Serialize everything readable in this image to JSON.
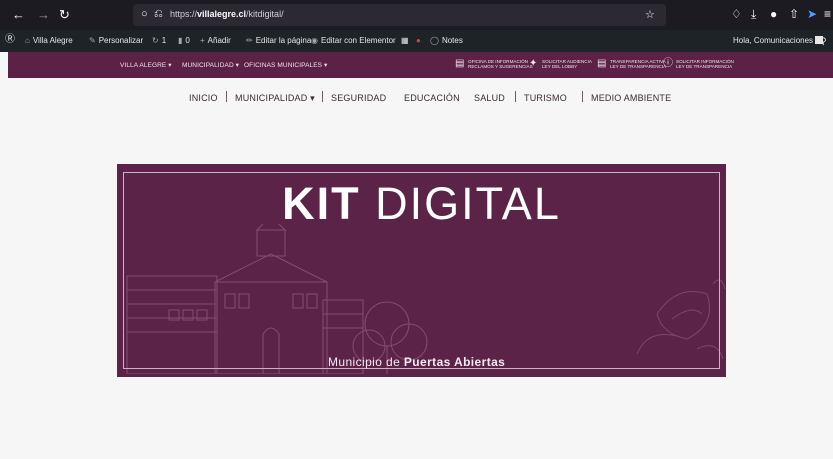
{
  "browser": {
    "url_prefix": "https://",
    "url_domain": "villalegre.cl",
    "url_path": "/kitdigital/"
  },
  "admin_bar": {
    "site_name": "Villa Alegre",
    "customize": "Personalizar",
    "updates_count": "1",
    "comments_count": "0",
    "add_new": "Añadir",
    "edit_page": "Editar la página",
    "edit_elementor": "Editar con Elementor",
    "notes": "Notes",
    "greeting": "Hola, Comunicaciones"
  },
  "top_bar": {
    "menus": [
      "VILLA ALEGRE",
      "MUNICIPALIDAD",
      "OFICINAS MUNICIPALES"
    ],
    "links": [
      {
        "line1": "OFICINA DE INFORMACIÓN",
        "line2": "RECLAMOS Y SUGERENCIAS"
      },
      {
        "line1": "SOLICITAR AUDIENCIA",
        "line2": "LEY DEL LOBBY"
      },
      {
        "line1": "TRANSPARENCIA ACTIVA",
        "line2": "LEY DE TRANSPARENCIA"
      },
      {
        "line1": "SOLICITAR INFORMACIÓN",
        "line2": "LEY DE TRANSPARENCIA"
      }
    ]
  },
  "main_nav": {
    "items": [
      "INICIO",
      "MUNICIPALIDAD",
      "SEGURIDAD",
      "EDUCACIÓN",
      "SALUD",
      "TURISMO",
      "MEDIO AMBIENTE"
    ]
  },
  "banner": {
    "title_bold": "KIT",
    "title_light": "DIGITAL",
    "subtitle_prefix": "Municipio de",
    "subtitle_bold": "Puertas Abiertas"
  },
  "colors": {
    "brand_purple": "#5c2246",
    "banner_purple": "#5c2349",
    "browser_dark": "#1c1b22",
    "admin_bar": "#1d2327"
  }
}
